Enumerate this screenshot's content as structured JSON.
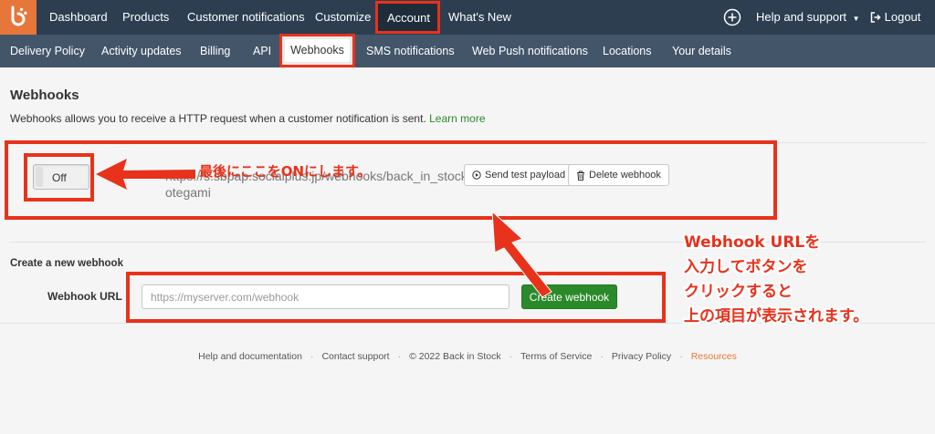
{
  "topnav": {
    "items": [
      {
        "label": "Dashboard"
      },
      {
        "label": "Products"
      },
      {
        "label": "Customer notifications"
      },
      {
        "label": "Customize"
      },
      {
        "label": "Account"
      },
      {
        "label": "What's New"
      }
    ],
    "help_label": "Help and support",
    "logout_label": "Logout"
  },
  "subnav": {
    "items": [
      {
        "label": "Delivery Policy"
      },
      {
        "label": "Activity updates"
      },
      {
        "label": "Billing"
      },
      {
        "label": "API"
      },
      {
        "label": "Webhooks"
      },
      {
        "label": "SMS notifications"
      },
      {
        "label": "Web Push notifications"
      },
      {
        "label": "Locations"
      },
      {
        "label": "Your details"
      }
    ]
  },
  "page": {
    "title": "Webhooks",
    "description": "Webhooks allows you to receive a HTTP request when a customer notification is sent.",
    "learn_more": "Learn more"
  },
  "webhook": {
    "toggle_label": "Off",
    "url_line1": "https://s.sbpap.socialplus.jp/webhooks/back_in_stock/te",
    "url_line2": "otegami",
    "send_test_label": "Send test payload",
    "delete_label": "Delete webhook"
  },
  "create": {
    "title": "Create a new webhook",
    "url_label": "Webhook URL",
    "url_placeholder": "https://myserver.com/webhook",
    "button_label": "Create webhook"
  },
  "footer": {
    "items": [
      {
        "label": "Help and documentation"
      },
      {
        "label": "Contact support"
      },
      {
        "label": "© 2022 Back in Stock"
      },
      {
        "label": "Terms of Service"
      },
      {
        "label": "Privacy Policy"
      },
      {
        "label": "Resources"
      }
    ]
  },
  "annotations": {
    "toggle_note": "最後にここをONにします。",
    "create_note_lines": [
      "Webhook URLを",
      "入力してボタンを",
      "クリックすると",
      "上の項目が表示されます。"
    ]
  },
  "colors": {
    "nav_bg": "#2c3e50",
    "subnav_bg": "#435569",
    "logo_orange": "#e6763a",
    "annotation_red": "#e8321b",
    "button_green": "#2a8a2a"
  }
}
